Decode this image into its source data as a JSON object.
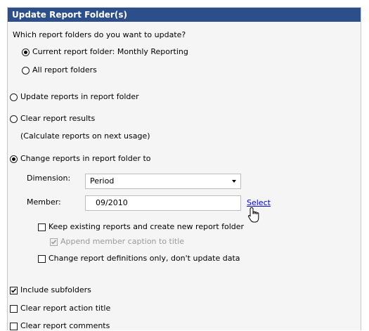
{
  "title": "Update Report Folder(s)",
  "folders_question": "Which report folders do you want to update?",
  "options": {
    "current_folder": "Current report folder: Monthly Reporting",
    "all_folders": "All report folders",
    "update_reports": "Update reports in report folder",
    "clear_results": "Clear report results",
    "clear_results_note": "(Calculate reports on next usage)",
    "change_reports": "Change reports in report folder to"
  },
  "dimension": {
    "label": "Dimension:",
    "value": "Period"
  },
  "member": {
    "label": "Member:",
    "value": "09/2010",
    "select_link": "Select"
  },
  "checkboxes": {
    "keep_existing": "Keep existing reports and create new report folder",
    "append_caption": "Append member caption to title",
    "change_definitions": "Change report definitions only, don't update data",
    "include_subfolders": "Include subfolders",
    "clear_action_title": "Clear report action title",
    "clear_comments": "Clear report comments"
  },
  "state": {
    "folder_scope": "current",
    "action": "change",
    "keep_existing": false,
    "append_caption": true,
    "append_caption_enabled": false,
    "change_definitions": false,
    "include_subfolders": true,
    "clear_action_title": false,
    "clear_comments": false
  },
  "colors": {
    "title_bar": "#2c4e8a",
    "link": "#0000ee",
    "panel": "#f5f5f5"
  }
}
